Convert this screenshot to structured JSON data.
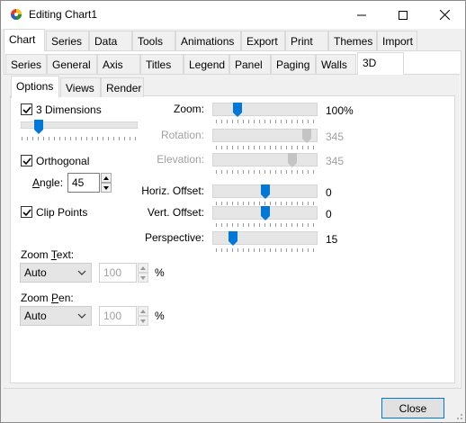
{
  "window": {
    "title": "Editing Chart1"
  },
  "main_tabs": [
    "Chart",
    "Series",
    "Data",
    "Tools",
    "Animations",
    "Export",
    "Print",
    "Themes",
    "Import"
  ],
  "sub_tabs": [
    "Series",
    "General",
    "Axis",
    "Titles",
    "Legend",
    "Panel",
    "Paging",
    "Walls",
    "3D"
  ],
  "option_tabs": [
    "Options",
    "Views",
    "Render"
  ],
  "options": {
    "three_dimensions": {
      "label": "3 Dimensions",
      "checked": true,
      "slider_level": 0.15
    },
    "orthogonal": {
      "label": "Orthogonal",
      "checked": true
    },
    "angle": {
      "label": "Angle:",
      "value": "45"
    },
    "clip_points": {
      "label": "Clip Points",
      "checked": true
    },
    "zoom_text": {
      "label": "Zoom Text:",
      "select_value": "Auto",
      "value": "100",
      "unit": "%"
    },
    "zoom_pen": {
      "label": "Zoom Pen:",
      "select_value": "Auto",
      "value": "100",
      "unit": "%"
    }
  },
  "sliders": {
    "zoom": {
      "label": "Zoom:",
      "value": "100%",
      "level": 0.2,
      "enabled": true
    },
    "rotation": {
      "label": "Rotation:",
      "value": "345",
      "level": 0.96,
      "enabled": false
    },
    "elevation": {
      "label": "Elevation:",
      "value": "345",
      "level": 0.8,
      "enabled": false
    },
    "horiz_offset": {
      "label": "Horiz. Offset:",
      "value": "0",
      "level": 0.5,
      "enabled": true
    },
    "vert_offset": {
      "label": "Vert. Offset:",
      "value": "0",
      "level": 0.5,
      "enabled": true
    },
    "perspective": {
      "label": "Perspective:",
      "value": "15",
      "level": 0.15,
      "enabled": true
    }
  },
  "footer": {
    "close_label": "Close"
  },
  "colors": {
    "accent": "#0078d7",
    "disabled_text": "#a0a0a0"
  }
}
